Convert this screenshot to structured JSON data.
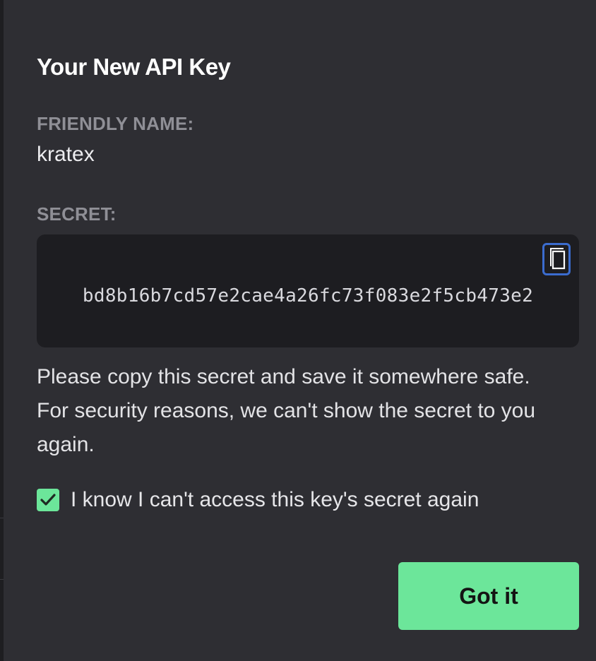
{
  "modal": {
    "title": "Your New API Key",
    "friendly_name_label": "FRIENDLY NAME:",
    "friendly_name_value": "kratex",
    "secret_label": "SECRET:",
    "secret_value": "bd8b16b7cd57e2cae4a26fc73f083e2f5cb473e2",
    "notice": "Please copy this secret and save it somewhere safe. For security reasons, we can't show the secret to you again.",
    "acknowledge": {
      "label": "I know I can't access this key's secret again",
      "checked": true
    },
    "confirm_button": "Got it"
  },
  "icons": {
    "copy": "copy-icon",
    "check": "checkmark-icon"
  },
  "colors": {
    "accent": "#6ce69a",
    "modal_background": "#2e2e33",
    "secret_background": "#1d1d21",
    "focus_ring": "#3b6ccf"
  }
}
